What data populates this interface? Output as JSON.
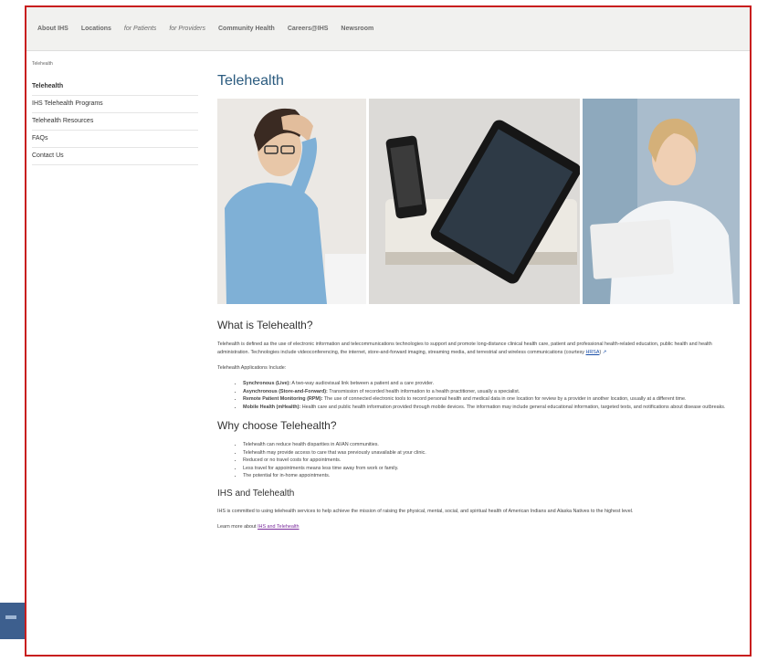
{
  "nav": {
    "items": [
      "About IHS",
      "Locations",
      "for Patients",
      "for Providers",
      "Community Health",
      "Careers@IHS",
      "Newsroom"
    ]
  },
  "breadcrumb": "Telehealth",
  "sidebar": {
    "items": [
      "Telehealth",
      "IHS Telehealth Programs",
      "Telehealth Resources",
      "FAQs",
      "Contact Us"
    ]
  },
  "main": {
    "title": "Telehealth",
    "what_heading": "What is Telehealth?",
    "what_text": "Telehealth is defined as the use of electronic information and telecommunications technologies to support and promote long-distance clinical health care, patient and professional health-related education, public health and health administration. Technologies include videoconferencing, the internet, store-and-forward imaging, streaming media, and terrestrial and wireless communications (courtesy",
    "what_link": "HRSA",
    "applications_intro": "Telehealth Applications Include:",
    "applications": [
      {
        "term": "Synchronous (Live):",
        "desc": " A two-way audiovisual link between a patient and a care provider."
      },
      {
        "term": "Asynchronous (Store-and-Forward):",
        "desc": " Transmission of recorded health information to a health practitioner, usually a specialist."
      },
      {
        "term": "Remote Patient Monitoring (RPM):",
        "desc": " The use of connected electronic tools to record personal health and medical data in one location for review by a provider in another location, usually at a different time."
      },
      {
        "term": "Mobile Health (mHealth):",
        "desc": " Health care and public health information provided through mobile devices. The information may include general educational information, targeted texts, and notifications about disease outbreaks."
      }
    ],
    "why_heading": "Why choose Telehealth?",
    "why_items": [
      "Telehealth can reduce health disparities in AI/AN communities.",
      "Telehealth may provide access to care that was previously unavailable at your clinic.",
      "Reduced or no travel costs for appointments.",
      "Less travel for appointments means less time away from work or family.",
      "The potential for in-home appointments."
    ],
    "ihs_heading": "IHS and Telehealth",
    "ihs_text": "IHS is committed to using telehealth services to help achieve the mission of raising the physical, mental, social, and spiritual health of American Indians and Alaska Natives to the highest level.",
    "learn_more_prefix": "Learn more about ",
    "learn_more_link": "IHS and Telehealth"
  },
  "colors": {
    "frame_border": "#c81e1e",
    "title": "#2b5b7f",
    "link": "#1a4fa8"
  }
}
